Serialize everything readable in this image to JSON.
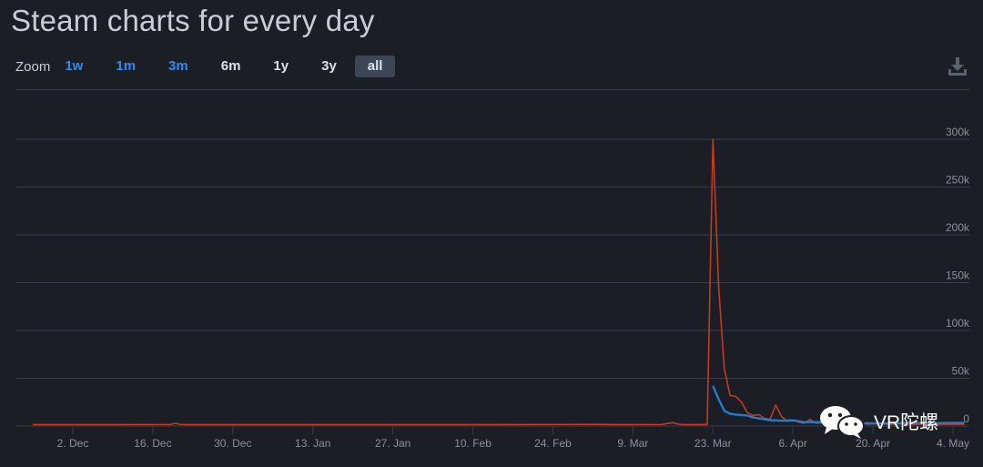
{
  "title": "Steam charts for every day",
  "zoom": {
    "label": "Zoom",
    "options": [
      {
        "label": "1w",
        "style": "blue"
      },
      {
        "label": "1m",
        "style": "blue"
      },
      {
        "label": "3m",
        "style": "blue"
      },
      {
        "label": "6m",
        "style": "white"
      },
      {
        "label": "1y",
        "style": "white"
      },
      {
        "label": "3y",
        "style": "white"
      },
      {
        "label": "all",
        "style": "active"
      }
    ]
  },
  "download_icon": "download-icon",
  "watermark": {
    "icon": "wechat-icon",
    "text": "VR陀螺"
  },
  "colors": {
    "background": "#1b1e24",
    "grid": "#3a3f47",
    "red_series": "#c23b22",
    "blue_series": "#1f7ed0",
    "tick_text": "#8b919a"
  },
  "chart_data": {
    "type": "line",
    "x_ticks": [
      "2. Dec",
      "16. Dec",
      "30. Dec",
      "13. Jan",
      "27. Jan",
      "10. Feb",
      "24. Feb",
      "9. Mar",
      "23. Mar",
      "6. Apr",
      "20. Apr",
      "4. May"
    ],
    "y_ticks": [
      "0",
      "50k",
      "100k",
      "150k",
      "200k",
      "250k",
      "300k"
    ],
    "ylim": [
      0,
      300000
    ],
    "grid": true,
    "series": [
      {
        "color": "#c23b22",
        "points": [
          [
            "2019-11-25",
            1500
          ],
          [
            "2019-12-09",
            1500
          ],
          [
            "2019-12-19",
            1600
          ],
          [
            "2019-12-20",
            2800
          ],
          [
            "2019-12-21",
            1500
          ],
          [
            "2020-01-15",
            1500
          ],
          [
            "2020-02-15",
            1500
          ],
          [
            "2020-03-03",
            1700
          ],
          [
            "2020-03-06",
            1500
          ],
          [
            "2020-03-14",
            1600
          ],
          [
            "2020-03-16",
            3500
          ],
          [
            "2020-03-17",
            1800
          ],
          [
            "2020-03-18",
            1500
          ],
          [
            "2020-03-21",
            1500
          ],
          [
            "2020-03-22",
            1700
          ],
          [
            "2020-03-23",
            300000
          ],
          [
            "2020-03-24",
            145000
          ],
          [
            "2020-03-25",
            60000
          ],
          [
            "2020-03-26",
            32000
          ],
          [
            "2020-03-27",
            31000
          ],
          [
            "2020-03-28",
            25000
          ],
          [
            "2020-03-29",
            14000
          ],
          [
            "2020-03-30",
            11000
          ],
          [
            "2020-03-31",
            12000
          ],
          [
            "2020-04-01",
            8000
          ],
          [
            "2020-04-02",
            7000
          ],
          [
            "2020-04-03",
            22000
          ],
          [
            "2020-04-04",
            10000
          ],
          [
            "2020-04-05",
            5000
          ],
          [
            "2020-04-06",
            6000
          ],
          [
            "2020-04-07",
            4000
          ],
          [
            "2020-04-08",
            3000
          ],
          [
            "2020-04-09",
            7000
          ],
          [
            "2020-04-10",
            3000
          ],
          [
            "2020-04-11",
            3500
          ],
          [
            "2020-04-12",
            5500
          ],
          [
            "2020-04-13",
            2500
          ],
          [
            "2020-04-15",
            2500
          ],
          [
            "2020-04-17",
            3500
          ],
          [
            "2020-04-19",
            2000
          ],
          [
            "2020-04-21",
            2500
          ],
          [
            "2020-04-23",
            1800
          ],
          [
            "2020-04-25",
            2500
          ],
          [
            "2020-04-27",
            1800
          ],
          [
            "2020-04-29",
            2000
          ],
          [
            "2020-05-01",
            1800
          ],
          [
            "2020-05-04",
            2000
          ],
          [
            "2020-05-06",
            1800
          ]
        ]
      },
      {
        "color": "#1f7ed0",
        "points": [
          [
            "2020-03-23",
            42000
          ],
          [
            "2020-03-24",
            28000
          ],
          [
            "2020-03-25",
            16000
          ],
          [
            "2020-03-26",
            13000
          ],
          [
            "2020-03-27",
            12000
          ],
          [
            "2020-03-28",
            11500
          ],
          [
            "2020-03-29",
            11000
          ],
          [
            "2020-03-30",
            9000
          ],
          [
            "2020-03-31",
            8000
          ],
          [
            "2020-04-01",
            7000
          ],
          [
            "2020-04-02",
            6000
          ],
          [
            "2020-04-03",
            6000
          ],
          [
            "2020-04-04",
            5500
          ],
          [
            "2020-04-06",
            6000
          ],
          [
            "2020-04-08",
            4000
          ],
          [
            "2020-04-10",
            4200
          ],
          [
            "2020-04-12",
            3500
          ],
          [
            "2020-04-15",
            3000
          ],
          [
            "2020-04-18",
            3000
          ],
          [
            "2020-04-21",
            2800
          ],
          [
            "2020-04-24",
            2800
          ],
          [
            "2020-04-27",
            3200
          ],
          [
            "2020-04-30",
            3000
          ],
          [
            "2020-05-03",
            3200
          ],
          [
            "2020-05-06",
            3400
          ]
        ]
      }
    ]
  }
}
